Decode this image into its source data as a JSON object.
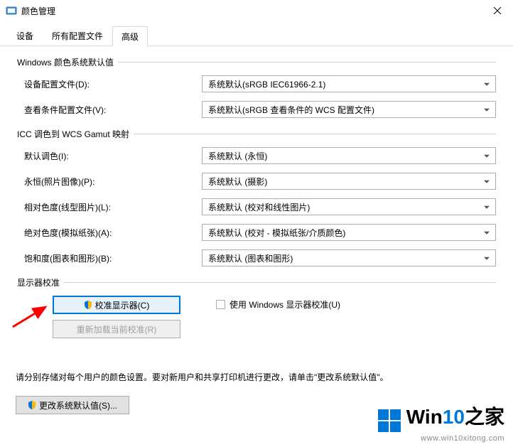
{
  "window": {
    "title": "颜色管理"
  },
  "tabs": {
    "items": [
      {
        "label": "设备"
      },
      {
        "label": "所有配置文件"
      },
      {
        "label": "高级"
      }
    ]
  },
  "group_defaults": {
    "legend": "Windows 颜色系统默认值",
    "device_profile_label": "设备配置文件(D):",
    "device_profile_value": "系统默认(sRGB IEC61966-2.1)",
    "viewing_label": "查看条件配置文件(V):",
    "viewing_value": "系统默认(sRGB 查看条件的 WCS 配置文件)"
  },
  "group_icc": {
    "legend": "ICC 调色到 WCS Gamut 映射",
    "default_intent_label": "默认调色(I):",
    "default_intent_value": "系统默认 (永恒)",
    "perceptual_label": "永恒(照片图像)(P):",
    "perceptual_value": "系统默认 (摄影)",
    "relative_label": "相对色度(线型图片)(L):",
    "relative_value": "系统默认 (校对和线性图片)",
    "absolute_label": "绝对色度(模拟纸张)(A):",
    "absolute_value": "系统默认 (校对 - 模拟纸张/介质颜色)",
    "saturation_label": "饱和度(图表和图形)(B):",
    "saturation_value": "系统默认 (图表和图形)"
  },
  "group_calib": {
    "legend": "显示器校准",
    "calibrate_btn": "校准显示器(C)",
    "reload_btn": "重新加载当前校准(R)",
    "use_windows_calib": "使用 Windows 显示器校准(U)"
  },
  "footer": {
    "note": "请分别存储对每个用户的颜色设置。要对新用户和共享打印机进行更改，请单击\"更改系统默认值\"。",
    "change_defaults_btn": "更改系统默认值(S)..."
  },
  "watermark": {
    "brand_a": "Win",
    "brand_b": "10",
    "brand_c": "之家",
    "url": "www.win10xitong.com"
  }
}
